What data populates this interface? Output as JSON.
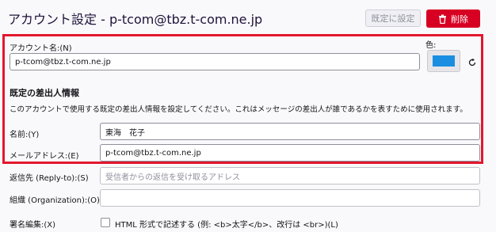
{
  "header": {
    "title": "アカウント設定 - p-tcom@tbz.t-com.ne.jp",
    "set_default_label": "既定に設定",
    "delete_label": "削除"
  },
  "account": {
    "name_label": "アカウント名:(N)",
    "name_value": "p-tcom@tbz.t-com.ne.jp",
    "color_label": "色:",
    "color_value": "#1a8ee1"
  },
  "identity": {
    "section_title": "既定の差出人情報",
    "description": "このアカウントで使用する既定の差出人情報を設定してください。これはメッセージの差出人が誰であるかを表すために使用されます。",
    "name_label": "名前:(Y)",
    "name_value": "東海　花子",
    "email_label": "メールアドレス:(E)",
    "email_value": "p-tcom@tbz.t-com.ne.jp",
    "reply_to_label": "返信先 (Reply-to):(S)",
    "reply_to_placeholder": "受信者からの返信を受け取るアドレス",
    "organization_label": "組織 (Organization):(O)",
    "organization_value": "",
    "signature_label": "署名編集:(X)",
    "html_signature_label": "HTML 形式で記述する (例: <b>太字</b>、改行は <br>)(L)"
  }
}
